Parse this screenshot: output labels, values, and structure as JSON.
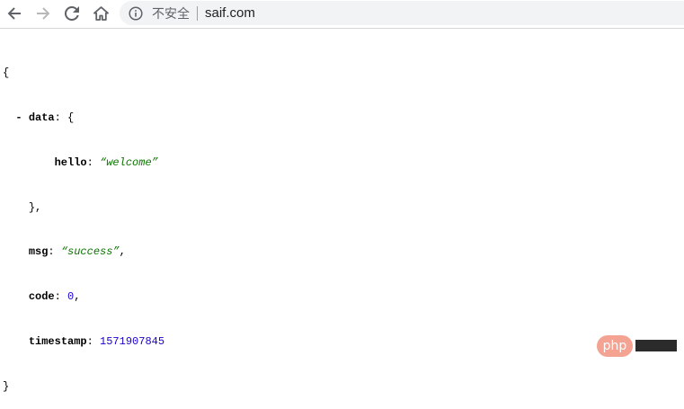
{
  "browser": {
    "security_label": "不安全",
    "url": "saif.com"
  },
  "json": {
    "open_brace": "{",
    "close_brace": "}",
    "toggle": "-",
    "data_key": "data",
    "hello_key": "hello",
    "hello_value": "“welcome”",
    "msg_key": "msg",
    "msg_value": "“success”",
    "code_key": "code",
    "code_value": "0",
    "timestamp_key": "timestamp",
    "timestamp_value": "1571907845",
    "colon": ":",
    "comma": ",",
    "inner_close": "},"
  },
  "watermark": {
    "text": "php"
  },
  "colors": {
    "string": "#0b7500",
    "number": "#1a01cc",
    "watermark_bg": "#f4a392"
  }
}
